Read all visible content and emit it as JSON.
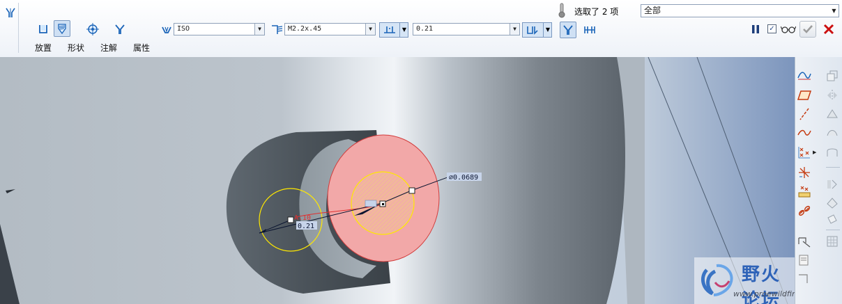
{
  "dashboard": {
    "tabs": [
      {
        "label": "放置"
      },
      {
        "label": "形状"
      },
      {
        "label": "注解"
      },
      {
        "label": "属性"
      }
    ],
    "standard": {
      "value": "ISO"
    },
    "size": {
      "value": "M2.2x.45"
    },
    "depth": {
      "value": "0.21"
    },
    "selection": {
      "label": "选取了 2 项",
      "filter": "全部"
    }
  },
  "viewport": {
    "dimensions": {
      "diameter": "⌀0.0689",
      "angle": "A.10",
      "offset": "0.21"
    },
    "watermark": {
      "title": "野火论坛",
      "url": "www.proewildfire.cn"
    }
  },
  "colors": {
    "hole_fill": "#f2a8a8",
    "highlight": "#ffe800",
    "accept": "#9c9c9c",
    "cancel": "#cc1010",
    "dim_bg": "#c7d4ea"
  },
  "icons": [
    "hole-tool-icon",
    "placement-icon",
    "shape-icon",
    "annotation-icon",
    "properties-icon",
    "hole-type-icon",
    "thread-icon",
    "depth-type-icon",
    "depth-side-icon",
    "countersink-icon",
    "counterbore-icon",
    "pause-icon",
    "preview-checkbox",
    "glasses-icon",
    "accept-icon",
    "cancel-icon"
  ]
}
